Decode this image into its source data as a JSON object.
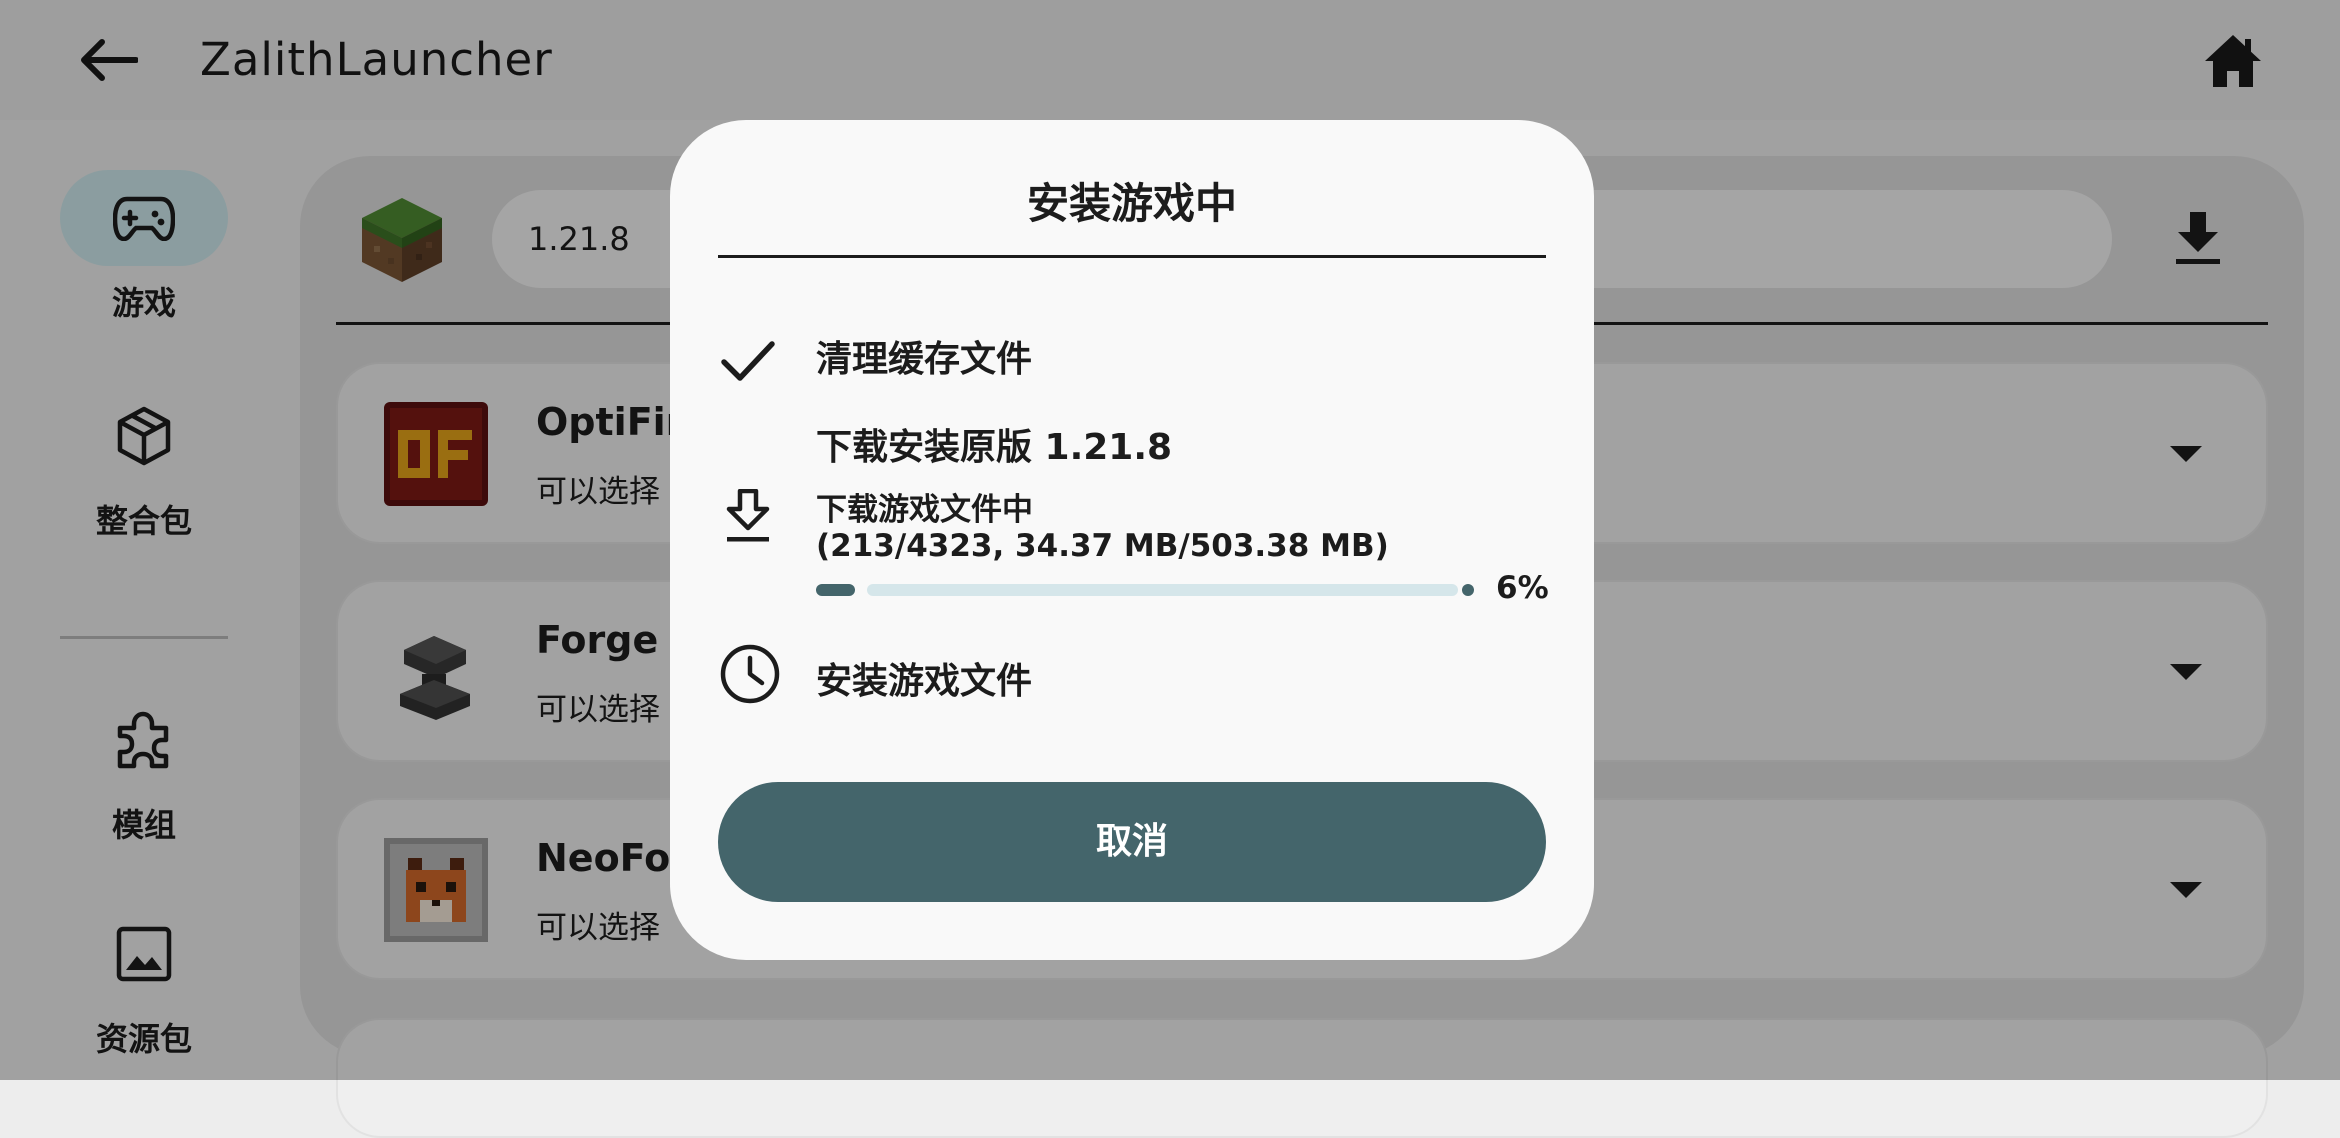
{
  "app": {
    "title": "ZalithLauncher"
  },
  "nav": {
    "items": [
      {
        "label": "游戏",
        "icon": "gamepad-icon",
        "active": true
      },
      {
        "label": "整合包",
        "icon": "package-icon",
        "active": false
      },
      {
        "label": "模组",
        "icon": "puzzle-icon",
        "active": false
      },
      {
        "label": "资源包",
        "icon": "image-icon",
        "active": false
      }
    ]
  },
  "main": {
    "version_value": "1.21.8",
    "loaders": [
      {
        "name": "OptiFin",
        "desc": "可以选择",
        "icon": "optifine-icon"
      },
      {
        "name": "Forge",
        "desc": "可以选择",
        "icon": "forge-anvil-icon"
      },
      {
        "name": "NeoFor",
        "desc": "可以选择",
        "icon": "neoforge-fox-icon"
      }
    ]
  },
  "dialog": {
    "title": "安装游戏中",
    "tasks": [
      {
        "status": "done",
        "icon": "check-icon",
        "label": "清理缓存文件"
      },
      {
        "status": "in-progress",
        "icon": "download-icon",
        "label": "下载安装原版 1.21.8",
        "sub_line1": "下载游戏文件中",
        "sub_line2": "(213/4323, 34.37 MB/503.38 MB)",
        "progress": 0.06,
        "progress_label": "6%"
      },
      {
        "status": "pending",
        "icon": "clock-icon",
        "label": "安装游戏文件"
      }
    ],
    "cancel_label": "取消"
  },
  "colors": {
    "accent": "#44656b",
    "accent_light": "#d5e6ea",
    "nav_active": "#cde8ec"
  }
}
